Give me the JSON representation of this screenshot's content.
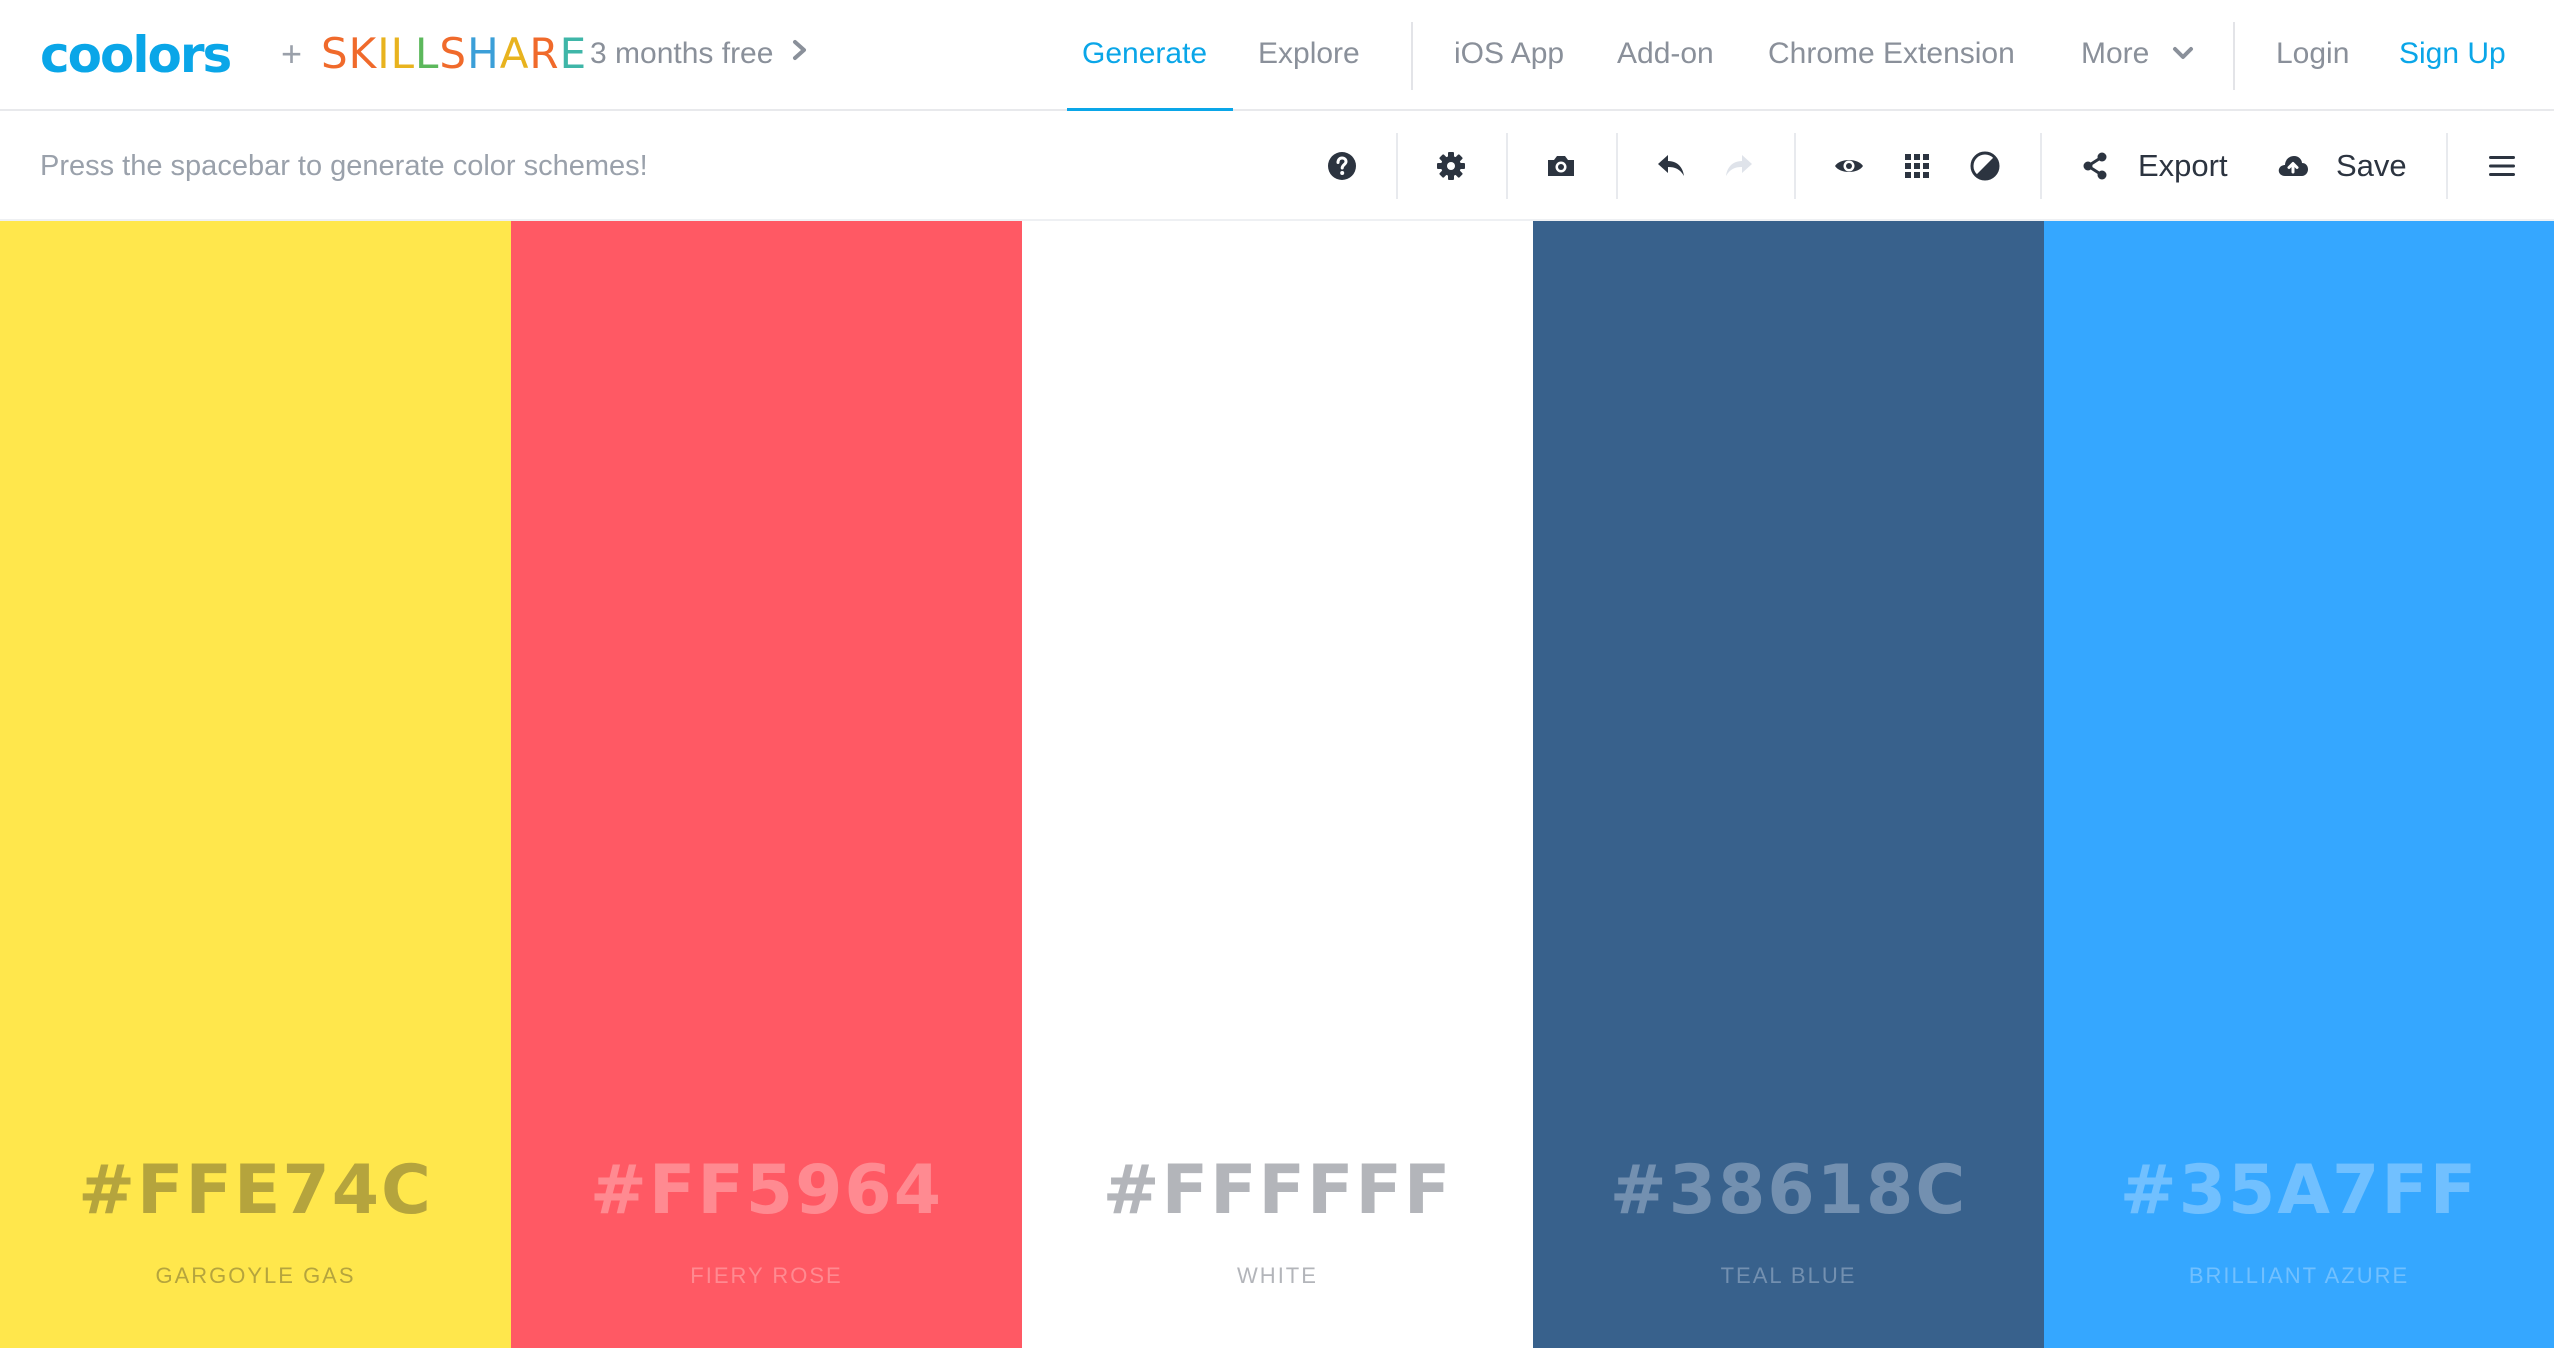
{
  "header": {
    "logo": "coolors",
    "plus": "+",
    "partner_letters": [
      {
        "ch": "S",
        "color": "#f06a2b"
      },
      {
        "ch": "K",
        "color": "#f06a2b"
      },
      {
        "ch": "I",
        "color": "#e8b31e"
      },
      {
        "ch": "L",
        "color": "#e8b31e"
      },
      {
        "ch": "L",
        "color": "#5cb85c"
      },
      {
        "ch": "S",
        "color": "#f06a2b"
      },
      {
        "ch": "H",
        "color": "#3b9fd8"
      },
      {
        "ch": "A",
        "color": "#e8b31e"
      },
      {
        "ch": "R",
        "color": "#f06a2b"
      },
      {
        "ch": "E",
        "color": "#3fb6a8"
      }
    ],
    "promo": "3 months free",
    "nav": {
      "generate": "Generate",
      "explore": "Explore",
      "ios_app": "iOS App",
      "addon": "Add-on",
      "chrome_extension": "Chrome Extension",
      "more": "More",
      "login": "Login",
      "signup": "Sign Up"
    },
    "accent_color": "#0aa6e8"
  },
  "toolbar": {
    "hint": "Press the spacebar to generate color schemes!",
    "export_label": "Export",
    "save_label": "Save",
    "icons": [
      "help-icon",
      "gear-icon",
      "camera-icon",
      "undo-icon",
      "redo-icon",
      "eye-icon",
      "grid-icon",
      "contrast-icon",
      "share-icon",
      "cloud-upload-icon",
      "hamburger-menu-icon"
    ]
  },
  "palette": {
    "colors": [
      {
        "hex": "#FFE74C",
        "name": "GARGOYLE GAS",
        "bg": "#FFE74C",
        "text_color": "#b5a43d"
      },
      {
        "hex": "#FF5964",
        "name": "FIERY ROSE",
        "bg": "#FF5964",
        "text_color": "#ff8a91"
      },
      {
        "hex": "#FFFFFF",
        "name": "WHITE",
        "bg": "#FFFFFF",
        "text_color": "#b3b5ba"
      },
      {
        "hex": "#38618C",
        "name": "TEAL BLUE",
        "bg": "#38618C",
        "text_color": "#7390b0"
      },
      {
        "hex": "#35A7FF",
        "name": "BRILLIANT AZURE",
        "bg": "#35A7FF",
        "text_color": "#71c0ff"
      }
    ]
  }
}
